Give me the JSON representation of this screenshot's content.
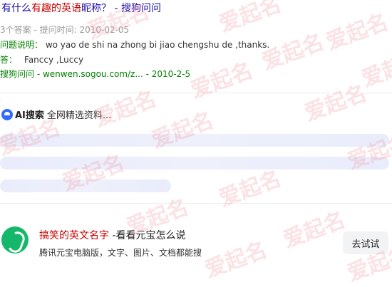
{
  "result": {
    "title_pre": "有什么",
    "title_hl1": "有趣的英语",
    "title_mid": "昵称？",
    "title_post": " - 搜狗问问",
    "meta": "3个答案 - 提问时间: 2010-02-05",
    "desc_label": "问题说明：",
    "desc_text": " wo yao de shi na zhong bi jiao chengshu de ,thanks.",
    "answer_label": "答：",
    "answer_text": "Fanccy ,Luccy",
    "source": "搜狗问问 - wenwen.sogou.com/z... - 2010-2-5"
  },
  "ai": {
    "icon": "ai-search-icon",
    "label": "AI搜索",
    "status": "全网精选资料..."
  },
  "ad": {
    "logo": "yuanbao-logo-icon",
    "title_hl": "搞笑的英文名字",
    "title_rest": " -看看元宝怎么说",
    "sub": "腾讯元宝电脑版，文字、图片、文档都能搜",
    "button": "去试试"
  },
  "watermark": "爱起名",
  "colors": {
    "link": "#1a0dab",
    "highlight": "#c00000",
    "green": "#008000",
    "accent": "#2f6bff",
    "logo_green": "#15b86a"
  }
}
